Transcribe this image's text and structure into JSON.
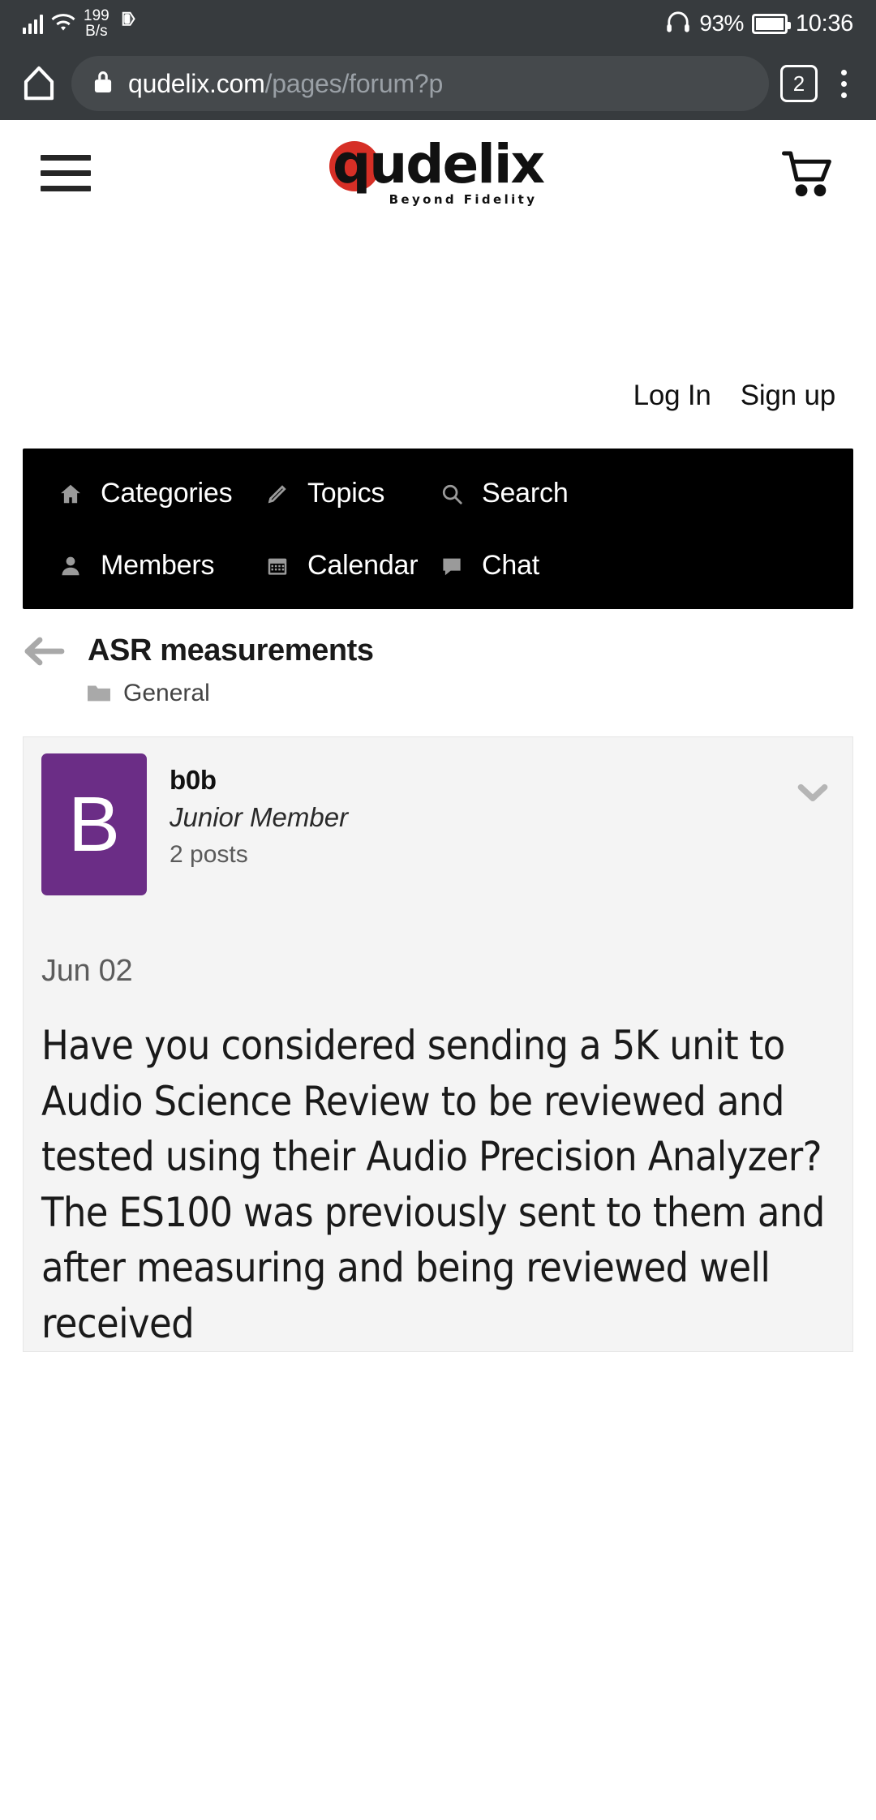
{
  "status_bar": {
    "network_speed_value": "199",
    "network_speed_unit": "B/s",
    "battery_percent": "93%",
    "clock": "10:36",
    "icons": [
      "signal-icon",
      "wifi-icon",
      "usb-icon",
      "headset-icon",
      "battery-icon"
    ]
  },
  "browser": {
    "url_domain": "qudelix.com",
    "url_path": "/pages/forum?p",
    "tab_count": "2",
    "icons": [
      "home-icon",
      "lock-icon",
      "tab-switcher-icon",
      "overflow-menu-icon"
    ]
  },
  "site_header": {
    "logo_letter": "q",
    "logo_text": "udelix",
    "logo_tagline": "Beyond Fidelity",
    "brand_red": "#d62f26",
    "icons": [
      "hamburger-icon",
      "cart-icon"
    ]
  },
  "auth": {
    "login_label": "Log In",
    "signup_label": "Sign up"
  },
  "forum_nav": {
    "rows": [
      [
        {
          "label": "Categories",
          "icon": "home-icon"
        },
        {
          "label": "Topics",
          "icon": "pencil-icon"
        },
        {
          "label": "Search",
          "icon": "search-icon"
        }
      ],
      [
        {
          "label": "Members",
          "icon": "person-icon"
        },
        {
          "label": "Calendar",
          "icon": "calendar-icon"
        },
        {
          "label": "Chat",
          "icon": "chat-bubble-icon"
        }
      ]
    ]
  },
  "breadcrumb": {
    "title": "ASR measurements",
    "category": "General"
  },
  "post": {
    "avatar_letter": "B",
    "avatar_color": "#6b2d86",
    "author": "b0b",
    "rank": "Junior Member",
    "post_count": "2 posts",
    "date": "Jun 02",
    "body": "Have you considered sending a 5K unit to Audio Science Review to be reviewed and tested using their Audio Precision Analyzer? The ES100 was previously sent to them and after measuring and being reviewed well received"
  }
}
